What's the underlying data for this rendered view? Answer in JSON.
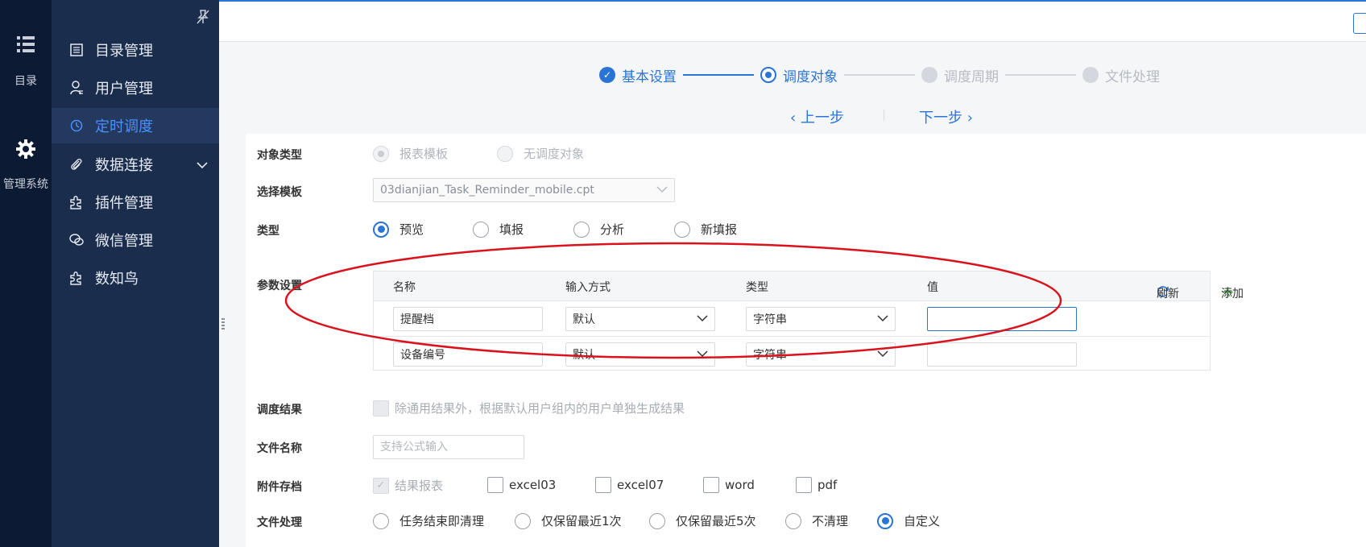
{
  "rail": {
    "items": [
      {
        "label": "目录",
        "icon": "list-icon"
      },
      {
        "label": "管理系统",
        "icon": "gear-icon"
      }
    ]
  },
  "menu": {
    "items": [
      {
        "label": "目录管理",
        "icon": "catalog-icon",
        "active": false
      },
      {
        "label": "用户管理",
        "icon": "user-icon",
        "active": false
      },
      {
        "label": "定时调度",
        "icon": "clock-icon",
        "active": true
      },
      {
        "label": "数据连接",
        "icon": "paperclip-icon",
        "active": false,
        "expandable": true
      },
      {
        "label": "插件管理",
        "icon": "puzzle-icon",
        "active": false
      },
      {
        "label": "微信管理",
        "icon": "wechat-icon",
        "active": false
      },
      {
        "label": "数知鸟",
        "icon": "puzzle-icon",
        "active": false
      }
    ]
  },
  "steps": [
    {
      "label": "基本设置",
      "state": "done"
    },
    {
      "label": "调度对象",
      "state": "current"
    },
    {
      "label": "调度周期",
      "state": "pending"
    },
    {
      "label": "文件处理",
      "state": "pending"
    }
  ],
  "nav": {
    "prev": "‹ 上一步",
    "next": "下一步 ›"
  },
  "form": {
    "object_type": {
      "label": "对象类型",
      "options": [
        {
          "label": "报表模板",
          "checked": true
        },
        {
          "label": "无调度对象",
          "checked": false
        }
      ]
    },
    "template": {
      "label": "选择模板",
      "value": "03dianjian_Task_Reminder_mobile.cpt"
    },
    "type": {
      "label": "类型",
      "options": [
        {
          "label": "预览",
          "checked": true
        },
        {
          "label": "填报",
          "checked": false
        },
        {
          "label": "分析",
          "checked": false
        },
        {
          "label": "新填报",
          "checked": false
        }
      ]
    },
    "params": {
      "label": "参数设置",
      "headers": [
        "名称",
        "输入方式",
        "类型",
        "值"
      ],
      "refresh": "刷新",
      "add": "添加",
      "rows": [
        {
          "name": "提醒档",
          "input_mode": "默认",
          "type": "字符串",
          "value": ""
        },
        {
          "name": "设备编号",
          "input_mode": "默认",
          "type": "字符串",
          "value": ""
        }
      ]
    },
    "result": {
      "label": "调度结果",
      "checkbox": "除通用结果外，根据默认用户组内的用户单独生成结果"
    },
    "file_name": {
      "label": "文件名称",
      "placeholder": "支持公式输入"
    },
    "attachments": {
      "label": "附件存档",
      "options": [
        {
          "label": "结果报表",
          "checked": true,
          "disabled": true
        },
        {
          "label": "excel03",
          "checked": false
        },
        {
          "label": "excel07",
          "checked": false
        },
        {
          "label": "word",
          "checked": false
        },
        {
          "label": "pdf",
          "checked": false
        }
      ]
    },
    "file_handling": {
      "label": "文件处理",
      "options": [
        {
          "label": "任务结束即清理",
          "checked": false
        },
        {
          "label": "仅保留最近1次",
          "checked": false
        },
        {
          "label": "仅保留最近5次",
          "checked": false
        },
        {
          "label": "不清理",
          "checked": false
        },
        {
          "label": "自定义",
          "checked": true
        }
      ]
    }
  },
  "colors": {
    "accent": "#2a74d5",
    "sidebar_bg": "#1a2d4d",
    "rail_bg": "#0c1a33",
    "annotation": "#d9121b"
  }
}
